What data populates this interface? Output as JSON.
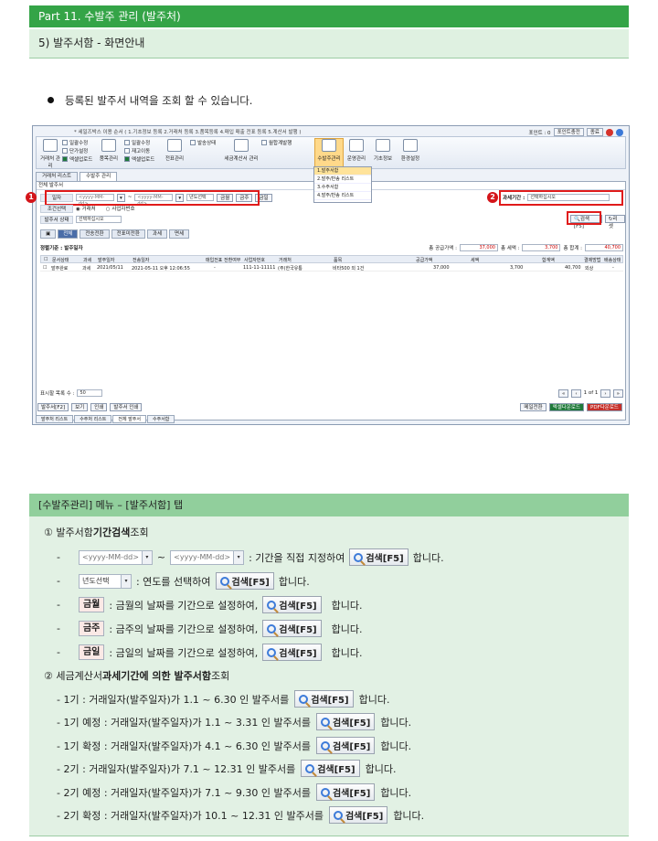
{
  "header": {
    "part_title": "Part 11. 수발주 관리 (발주처)",
    "section_title": "5) 발주서함 - 화면안내"
  },
  "intro": {
    "bullet_text": "등록된 발주서 내역을 조회 할 수 있습니다."
  },
  "screenshot": {
    "notice": "* 세일즈박스 이용 순서 ( 1.기초정보 등록  2.거래처 등록  3.품목등록  4.매입 매출 전표 등록  5.계산서 발행 )",
    "top_right": {
      "point_label": "포인트 : 0",
      "point_charge": "포인트충전",
      "exit": "종료"
    },
    "ribbon": {
      "groups": [
        {
          "label": "거래처 관리"
        },
        {
          "label": "품목관리"
        },
        {
          "label": "전표관리"
        },
        {
          "label": "세금계산서 관리"
        },
        {
          "label": "수발주관리"
        },
        {
          "label": "운영관리"
        },
        {
          "label": "기초정보"
        },
        {
          "label": "환경설정"
        }
      ],
      "small_items": [
        "일괄수정",
        "단가설정",
        "엑셀업로드",
        "일괄수정",
        "재고이동",
        "엑셀업로드",
        "발송상태",
        "월합계발행"
      ]
    },
    "dropdown_menu": [
      "1.발주서함",
      "2.발주/반송 리스트",
      "3.수주서함",
      "4.발주/반송 리스트"
    ],
    "tabs": [
      "거래처 리스트",
      "수발주 관리"
    ],
    "panel_title": "전체 발주서",
    "search": {
      "date_label": "일자",
      "date_from_placeholder": "<yyyy-MM-dd>",
      "date_to_placeholder": "<yyyy-MM-dd>",
      "year_select": "년도선택",
      "btn_month": "금월",
      "btn_week": "금주",
      "btn_day": "금일",
      "tax_period_label": "과세기간 :",
      "tax_period_value": "선택하십시오",
      "condition_label": "조건선택",
      "radio_partner": "거래처",
      "radio_bizno": "사업자번호",
      "status_label": "발주서 상태",
      "status_value": "선택하십시오",
      "search_btn": "검색[F5]",
      "reset_btn": "리셋"
    },
    "filter_tabs": [
      "전체",
      "전송전환",
      "전표미전환",
      "과세",
      "면세"
    ],
    "summary": {
      "criteria": "정렬기준 : 발주일자",
      "supply_label": "총 공급가액 :",
      "supply_value": "37,000",
      "tax_label": "총 세액 :",
      "tax_value": "3,700",
      "total_label": "총 합계 :",
      "total_value": "40,700"
    },
    "grid": {
      "columns": [
        "문서상태",
        "과세",
        "발주일자",
        "전송일자",
        "매입전표 전환여부",
        "사업자번호",
        "거래처",
        "품목",
        "공급가액",
        "세액",
        "합계액",
        "결제방법",
        "배송상태"
      ],
      "rows": [
        [
          "발주완료",
          "과세",
          "2021/05/11",
          "2021-05-11 오후 12:06:55",
          "-",
          "111-11-11111",
          "(주)한국유통",
          "비타500 외 1건",
          "37,000",
          "3,700",
          "40,700",
          "외상",
          "-"
        ]
      ]
    },
    "pager": {
      "rows_label": "표시할 목록 수 :",
      "rows_value": "50",
      "page_text": "1 of 1"
    },
    "bottom_buttons": [
      "발주서[F2]",
      "보기",
      "인쇄",
      "발주서 인쇄",
      "메일전환",
      "엑셀다운로드",
      "PDF다운로드"
    ],
    "bottom_tabs": [
      "발주처 리스트",
      "수주처 리스트",
      "전체 발주서",
      "수주서함"
    ]
  },
  "section2": {
    "bar_title": "[수발주관리] 메뉴 – [발주서함] 탭",
    "item1_title_prefix": "①  발주서함 ",
    "item1_title_bold": "기간검색",
    "item1_title_suffix": " 조회",
    "date_from": "<yyyy-MM-dd>",
    "tilde": "~",
    "date_to": "<yyyy-MM-dd>",
    "line1_text": ":  기간을 직접 지정하여",
    "year_select": "년도선택",
    "line2_text": ": 연도를 선택하여",
    "btn_month": "금월",
    "line3_text": ": 금월의 날짜를 기간으로 설정하여,",
    "btn_week": "금주",
    "line4_text": ": 금주의 날짜를 기간으로 설정하여,",
    "btn_day": "금일",
    "line5_text": ": 금일의 날짜를 기간으로 설정하여,",
    "search_btn": "검색[F5]",
    "hamnida": "합니다.",
    "item2_title_prefix": "②  세금계산서 ",
    "item2_title_bold": "과세기간에 의한 발주서함",
    "item2_title_suffix": " 조회",
    "periods": [
      "- 1기 : 거래일자(발주일자)가  1.1 ~ 6.30 인 발주서를",
      "- 1기 예정 : 거래일자(발주일자)가  1.1 ~ 3.31 인 발주서를",
      "- 1기 확정 : 거래일자(발주일자)가  4.1 ~ 6.30 인 발주서를",
      "- 2기 : 거래일자(발주일자)가  7.1 ~ 12.31 인 발주서를",
      "- 2기 예정 : 거래일자(발주일자)가  7.1 ~ 9.30 인 발주서를",
      "- 2기 확정 : 거래일자(발주일자)가  10.1 ~ 12.31 인 발주서를"
    ]
  }
}
